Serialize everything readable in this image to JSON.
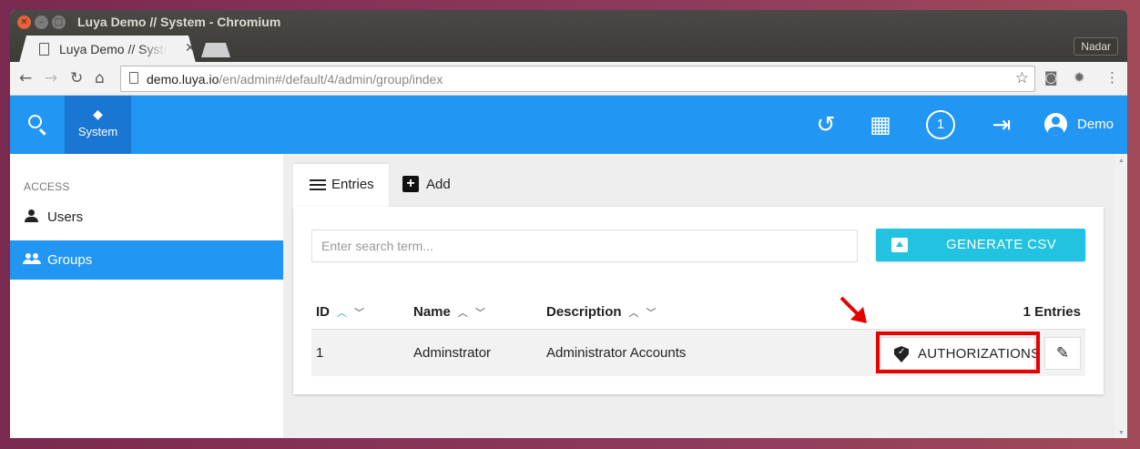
{
  "window": {
    "title": "Luya Demo // System - Chromium",
    "profile": "Nadar"
  },
  "browser": {
    "tab_title": "Luya Demo // System",
    "tab_close": "✕",
    "url_host": "demo.luya.io",
    "url_path": "/en/admin#/default/4/admin/group/index"
  },
  "header": {
    "system_label": "System",
    "notification_count": "1",
    "user_name": "Demo"
  },
  "sidebar": {
    "category": "ACCESS",
    "items": [
      {
        "label": "Users",
        "icon": "person-icon",
        "active": false
      },
      {
        "label": "Groups",
        "icon": "group-icon",
        "active": true
      }
    ]
  },
  "main": {
    "tabs": [
      {
        "label": "Entries",
        "icon": "hamburger-icon",
        "active": true
      },
      {
        "label": "Add",
        "icon": "plus-icon",
        "active": false
      }
    ],
    "search_placeholder": "Enter search term...",
    "csv_button": "GENERATE CSV",
    "table": {
      "columns": [
        "ID",
        "Name",
        "Description"
      ],
      "entries_count": "1 Entries",
      "rows": [
        {
          "id": "1",
          "name": "Adminstrator",
          "description": "Administrator Accounts"
        }
      ],
      "action_label": "AUTHORIZATIONS"
    }
  },
  "colors": {
    "primary": "#2196f3",
    "primary_dark": "#1976d2",
    "csv_button": "#21c3e0",
    "highlight": "#e60000"
  }
}
